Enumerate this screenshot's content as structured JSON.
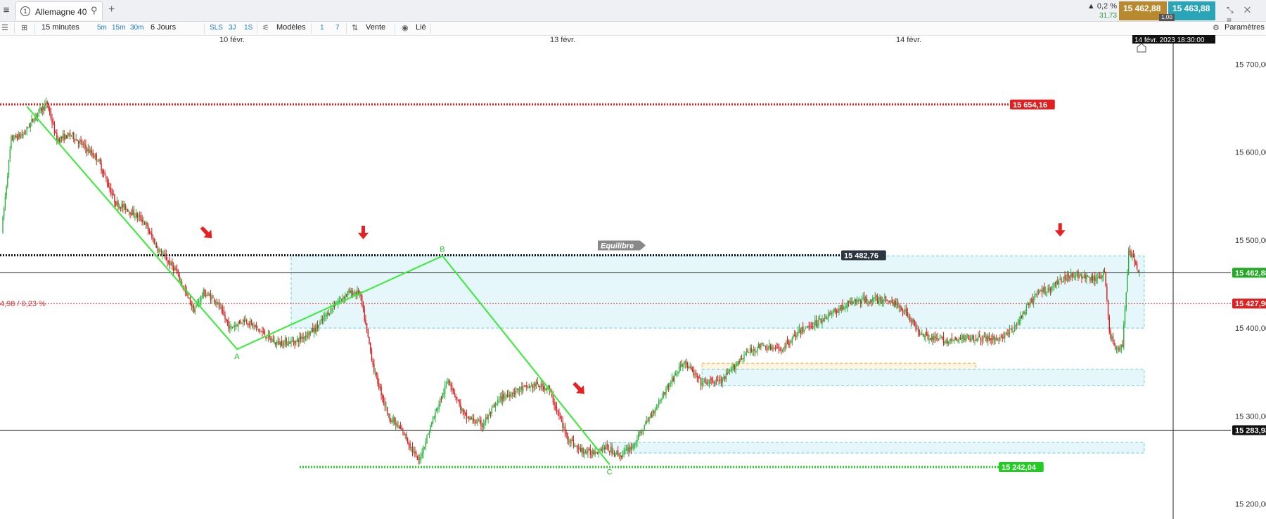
{
  "header": {
    "menu_icon": "hamburger-icon",
    "tab_number": "1",
    "instrument": "Allemagne 40",
    "change_pct": "▲ 0,2 %",
    "change_abs": "31,73",
    "bid": "15 462,88",
    "ask": "15 463,88",
    "spread": "1,00",
    "window_icons": "⤡ ✕ ≡"
  },
  "toolbar": {
    "interval": "15 minutes",
    "quick_intervals": [
      "5m",
      "15m",
      "30m"
    ],
    "period": "6 Jours",
    "buttons": [
      "SLS",
      "3J",
      "1S"
    ],
    "models_label": "Modèles",
    "numbers": [
      "1",
      "7"
    ],
    "sell_label": "Vente",
    "linked_label": "Lié",
    "settings_label": "Paramètres"
  },
  "colors": {
    "up": "#2bb23b",
    "down": "#d62020",
    "pattern_line": "#33ee33",
    "resistance": "#e02020",
    "support": "#22cc22",
    "zone_fill": "#e6f7fc",
    "zone_border": "#66ccdd",
    "equilibrium": "#000000",
    "current_price_tag": "#22aa22"
  },
  "chart_data": {
    "type": "candlestick",
    "instrument": "Allemagne 40",
    "timeframe": "15 minutes",
    "x_labels": [
      "10 févr.",
      "13 févr.",
      "14 févr."
    ],
    "cursor_time": "14 févr. 2023 18:30:00",
    "y_ticks": [
      "15 700,00",
      "15 600,00",
      "15 500,00",
      "15 400,00",
      "15 300,00",
      "15 200,00"
    ],
    "ylim": [
      15183,
      15733
    ],
    "levels": [
      {
        "label": "15 654,16",
        "value": 15654.16,
        "style": "dotted-red"
      },
      {
        "label": "15 482,76",
        "value": 15482.76,
        "style": "dotted-black"
      },
      {
        "label": "15 462,88",
        "value": 15462.88,
        "style": "current-price"
      },
      {
        "label": "15 427,90",
        "value": 15427.9,
        "style": "dotted-red-thin"
      },
      {
        "label": "15 283,93",
        "value": 15283.93,
        "style": "solid-black"
      },
      {
        "label": "15 242,04",
        "value": 15242.04,
        "style": "dotted-green"
      }
    ],
    "left_partial_label": "4,98 / 0,23 %",
    "equilibrium_label": "Equilibre",
    "pattern_points": [
      {
        "label": "",
        "index": 20,
        "price": 15652
      },
      {
        "label": "A",
        "index": 195,
        "price": 15376
      },
      {
        "label": "B",
        "index": 366,
        "price": 15482
      },
      {
        "label": "C",
        "index": 505,
        "price": 15245
      }
    ],
    "zones": [
      {
        "start": 240,
        "end": 950,
        "high": 15482,
        "low": 15400,
        "color": "cyan"
      },
      {
        "start": 582,
        "end": 810,
        "high": 15360,
        "low": 15350,
        "color": "orange"
      },
      {
        "start": 582,
        "end": 950,
        "high": 15353,
        "low": 15335,
        "color": "cyan"
      },
      {
        "start": 500,
        "end": 950,
        "high": 15270,
        "low": 15258,
        "color": "cyan"
      }
    ],
    "arrows": [
      {
        "index": 172,
        "price": 15505,
        "direction": "down-right"
      },
      {
        "index": 300,
        "price": 15505,
        "direction": "down"
      },
      {
        "index": 482,
        "price": 15328,
        "direction": "down-right"
      },
      {
        "index": 880,
        "price": 15508,
        "direction": "down"
      }
    ],
    "candles_path": [
      [
        0,
        15510
      ],
      [
        8,
        15615
      ],
      [
        18,
        15620
      ],
      [
        30,
        15645
      ],
      [
        38,
        15655
      ],
      [
        46,
        15614
      ],
      [
        58,
        15620
      ],
      [
        80,
        15592
      ],
      [
        95,
        15542
      ],
      [
        105,
        15535
      ],
      [
        118,
        15522
      ],
      [
        130,
        15490
      ],
      [
        145,
        15465
      ],
      [
        160,
        15420
      ],
      [
        168,
        15440
      ],
      [
        178,
        15432
      ],
      [
        190,
        15400
      ],
      [
        202,
        15410
      ],
      [
        215,
        15397
      ],
      [
        228,
        15383
      ],
      [
        245,
        15385
      ],
      [
        262,
        15400
      ],
      [
        276,
        15425
      ],
      [
        288,
        15440
      ],
      [
        298,
        15440
      ],
      [
        310,
        15352
      ],
      [
        322,
        15300
      ],
      [
        335,
        15280
      ],
      [
        347,
        15248
      ],
      [
        360,
        15300
      ],
      [
        372,
        15342
      ],
      [
        385,
        15300
      ],
      [
        400,
        15290
      ],
      [
        415,
        15320
      ],
      [
        430,
        15330
      ],
      [
        445,
        15335
      ],
      [
        455,
        15332
      ],
      [
        470,
        15278
      ],
      [
        480,
        15262
      ],
      [
        490,
        15258
      ],
      [
        502,
        15265
      ],
      [
        515,
        15255
      ],
      [
        526,
        15267
      ],
      [
        540,
        15300
      ],
      [
        555,
        15335
      ],
      [
        568,
        15362
      ],
      [
        582,
        15338
      ],
      [
        600,
        15340
      ],
      [
        618,
        15370
      ],
      [
        632,
        15380
      ],
      [
        648,
        15375
      ],
      [
        664,
        15396
      ],
      [
        680,
        15408
      ],
      [
        695,
        15420
      ],
      [
        708,
        15430
      ],
      [
        722,
        15432
      ],
      [
        738,
        15432
      ],
      [
        752,
        15420
      ],
      [
        762,
        15398
      ],
      [
        775,
        15388
      ],
      [
        790,
        15385
      ],
      [
        805,
        15390
      ],
      [
        818,
        15388
      ],
      [
        830,
        15388
      ],
      [
        842,
        15398
      ],
      [
        852,
        15420
      ],
      [
        862,
        15440
      ],
      [
        872,
        15445
      ],
      [
        882,
        15455
      ],
      [
        892,
        15462
      ],
      [
        902,
        15457
      ],
      [
        912,
        15455
      ],
      [
        918,
        15465
      ],
      [
        922,
        15395
      ],
      [
        928,
        15375
      ],
      [
        933,
        15380
      ],
      [
        938,
        15485
      ],
      [
        942,
        15482
      ],
      [
        946,
        15463
      ]
    ],
    "candle_count": 947,
    "last_price": 15462.88
  }
}
